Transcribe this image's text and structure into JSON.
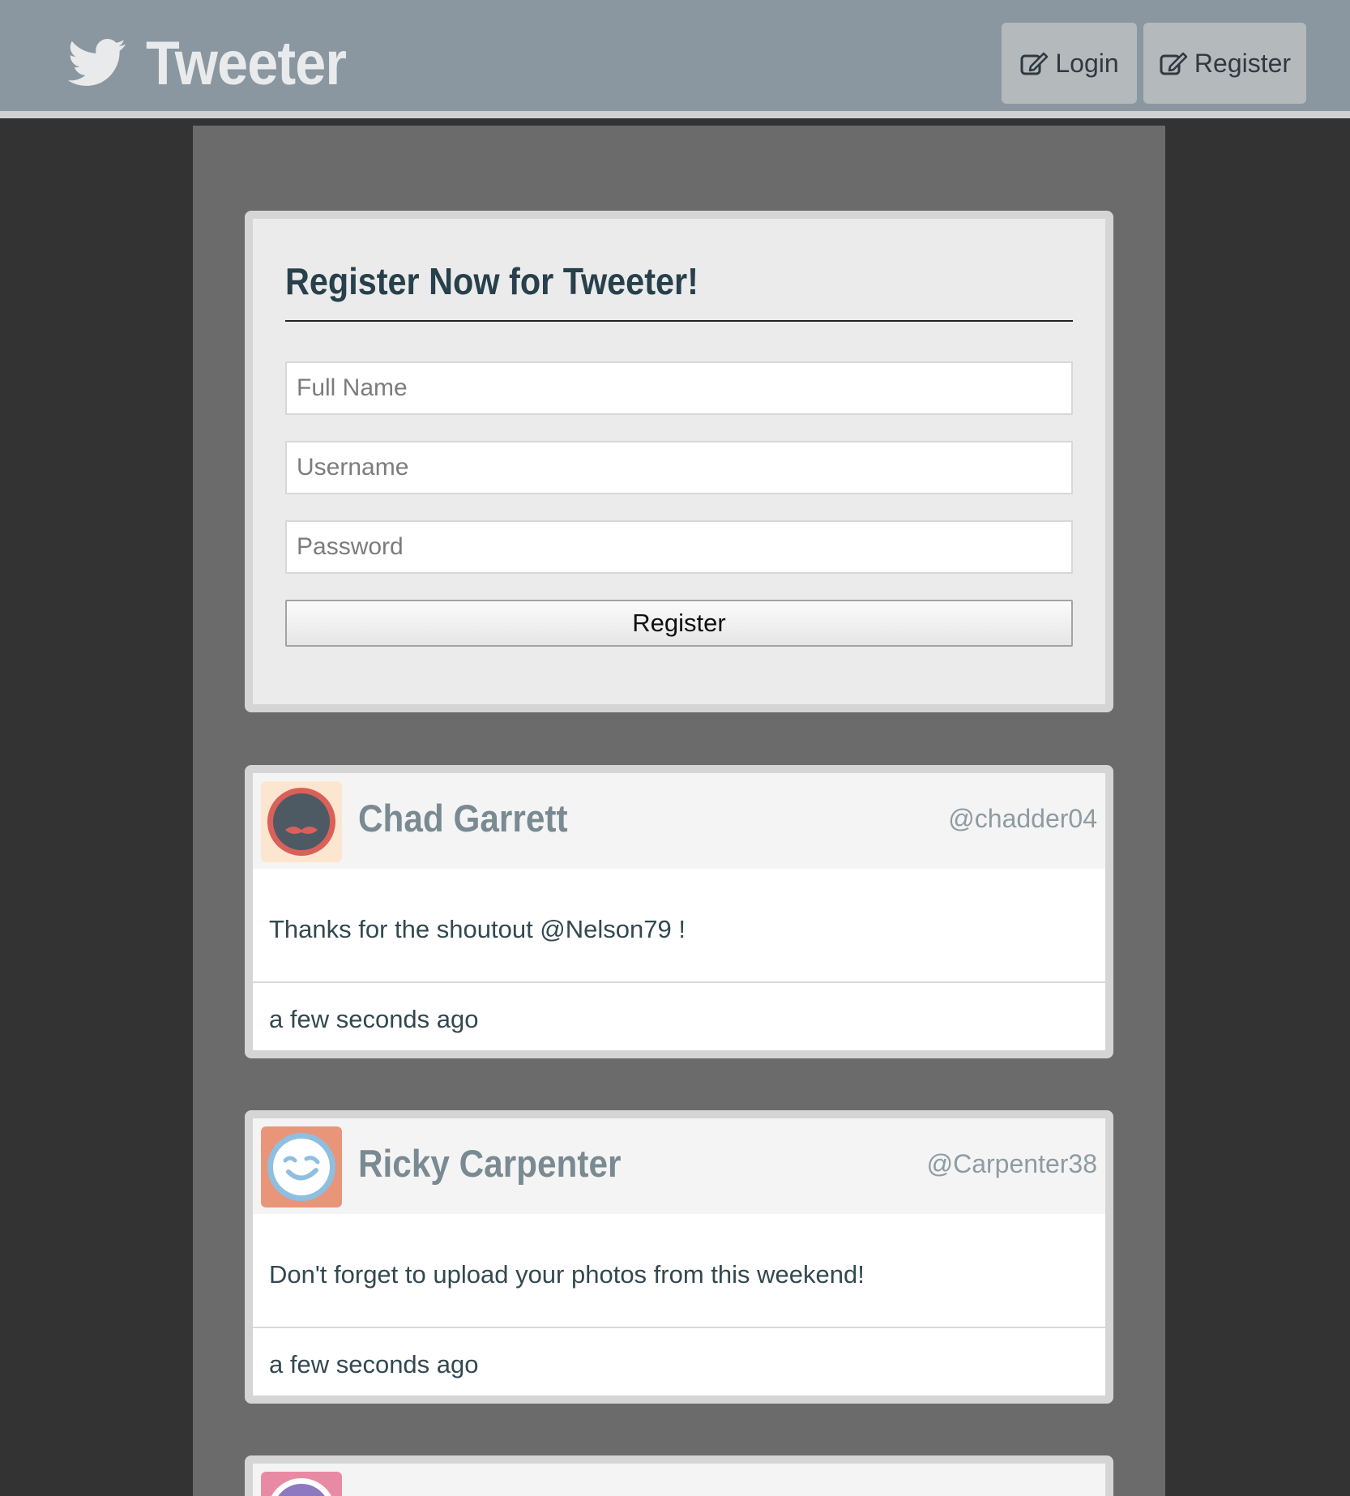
{
  "header": {
    "brand_icon": "twitter-bird-icon",
    "brand_title": "Tweeter",
    "login_label": "Login",
    "register_label": "Register",
    "nav_icon": "edit-icon"
  },
  "register_form": {
    "title": "Register Now for Tweeter!",
    "full_name_placeholder": "Full Name",
    "username_placeholder": "Username",
    "password_placeholder": "Password",
    "submit_label": "Register"
  },
  "tweets": [
    {
      "name": "Chad Garrett",
      "handle": "@chadder04",
      "text": "Thanks for the shoutout @Nelson79 !",
      "time": "a few seconds ago",
      "avatar_bg": "#fde6cf",
      "avatar_ring": "#d9615a",
      "avatar_face": "#4e5a63"
    },
    {
      "name": "Ricky Carpenter",
      "handle": "@Carpenter38",
      "text": "Don't forget to upload your photos from this weekend!",
      "time": "a few seconds ago",
      "avatar_bg": "#e8957a",
      "avatar_ring": "#8fbfe0",
      "avatar_face": "#ffffff"
    },
    {
      "avatar_bg": "#e88aa3",
      "avatar_ring": "#ffffff",
      "avatar_face": "#8d78c2"
    }
  ]
}
